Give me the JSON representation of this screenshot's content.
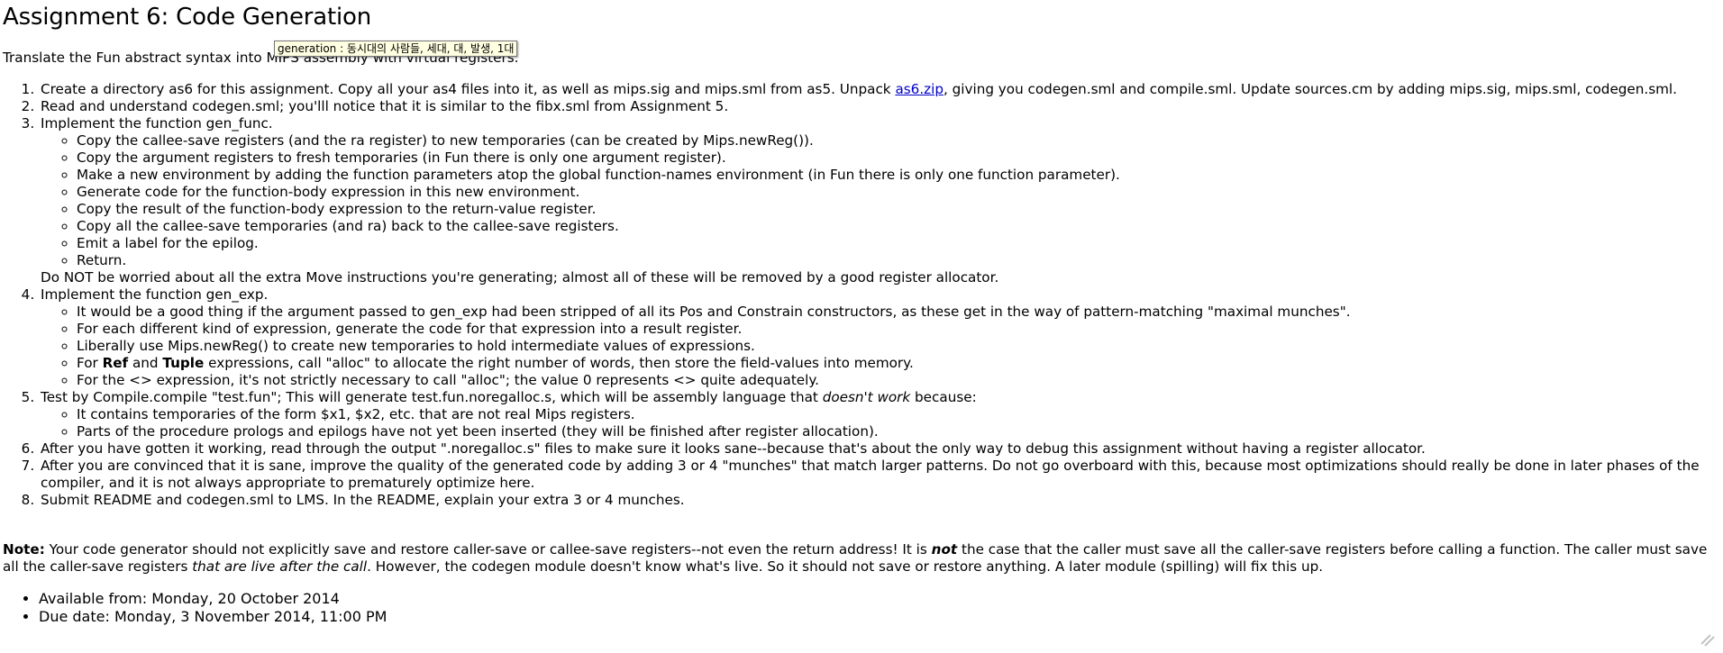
{
  "title": "Assignment 6: Code Generation",
  "tooltip": "generation : 동시대의 사람들, 세대, 대, 발생, 1대",
  "intro": "Translate the Fun abstract syntax into MIPS assembly with virtual registers.",
  "steps": {
    "s1_pre": "Create a directory as6 for this assignment. Copy all your as4 files into it, as well as mips.sig and mips.sml from as5. Unpack ",
    "s1_link": "as6.zip",
    "s1_post": ", giving you codegen.sml and compile.sml. Update sources.cm by adding mips.sig, mips.sml, codegen.sml.",
    "s2": "Read and understand codegen.sml; you'lll notice that it is similar to the fibx.sml from Assignment 5.",
    "s3": "Implement the function gen_func.",
    "s3_sub": [
      "Copy the callee-save registers (and the ra register) to new temporaries (can be created by Mips.newReg()).",
      "Copy the argument registers to fresh temporaries (in Fun there is only one argument register).",
      "Make a new environment by adding the function parameters atop the global function-names environment (in Fun there is only one function parameter).",
      "Generate code for the function-body expression in this new environment.",
      "Copy the result of the function-body expression to the return-value register.",
      "Copy all the callee-save temporaries (and ra) back to the callee-save registers.",
      "Emit a label for the epilog.",
      "Return."
    ],
    "s3_after": "Do NOT be worried about all the extra Move instructions you're generating; almost all of these will be removed by a good register allocator.",
    "s4": "Implement the function gen_exp.",
    "s4_sub1": "It would be a good thing if the argument passed to gen_exp had been stripped of all its Pos and Constrain constructors, as these get in the way of pattern-matching \"maximal munches\".",
    "s4_sub2": "For each different kind of expression, generate the code for that expression into a result register.",
    "s4_sub3": "Liberally use Mips.newReg() to create new temporaries to hold intermediate values of expressions.",
    "s4_sub4_a": "For ",
    "s4_sub4_ref": "Ref",
    "s4_sub4_and": " and ",
    "s4_sub4_tuple": "Tuple",
    "s4_sub4_b": " expressions, call \"alloc\" to allocate the right number of words, then store the field-values into memory.",
    "s4_sub5": "For the <> expression, it's not strictly necessary to call \"alloc\"; the value 0 represents <> quite adequately.",
    "s5_pre": "Test by Compile.compile \"test.fun\"; This will generate test.fun.noregalloc.s, which will be assembly language that ",
    "s5_em": "doesn't work",
    "s5_post": " because:",
    "s5_sub": [
      "It contains temporaries of the form $x1, $x2, etc. that are not real Mips registers.",
      "Parts of the procedure prologs and epilogs have not yet been inserted (they will be finished after register allocation)."
    ],
    "s6": "After you have gotten it working, read through the output \".noregalloc.s\" files to make sure it looks sane--because that's about the only way to debug this assignment without having a register allocator.",
    "s7": "After you are convinced that it is sane, improve the quality of the generated code by adding 3 or 4 \"munches\" that match larger patterns. Do not go overboard with this, because most optimizations should really be done in later phases of the compiler, and it is not always appropriate to prematurely optimize here.",
    "s8": "Submit README and codegen.sml to LMS. In the README, explain your extra 3 or 4 munches."
  },
  "note": {
    "label": "Note:",
    "t1": " Your code generator should not explicitly save and restore caller-save or callee-save registers--not even the return address! It is ",
    "em_not": "not",
    "t2": " the case that the caller must save all the caller-save registers before calling a function. The caller must save all the caller-save registers ",
    "em_live": "that are live after the call",
    "t3": ". However, the codegen module doesn't know what's live. So it should not save or restore anything. A later module (spilling) will fix this up."
  },
  "dates": {
    "available": "Available from: Monday, 20 October 2014",
    "due": "Due date: Monday, 3 November 2014, 11:00 PM"
  },
  "corner_icon": "resize-grip-icon"
}
